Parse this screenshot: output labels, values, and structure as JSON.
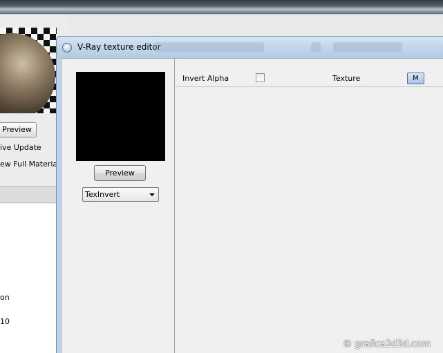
{
  "background_window": {
    "preview_label": "Preview",
    "checkboxes": [
      "ive Update",
      "ew Full Material"
    ],
    "rows": [
      "on",
      "10"
    ]
  },
  "dialog": {
    "title": "V-Ray texture editor",
    "preview_button": "Preview",
    "texture_type": "TexInvert",
    "params": {
      "invert_alpha_label": "Invert Alpha",
      "invert_alpha_checked": false,
      "texture_label": "Texture",
      "texture_map_button": "M"
    }
  },
  "watermark": "© grafica2d3d.com",
  "colors": {
    "titlebar": "#c3d7ea",
    "client_bg": "#f0f0f0",
    "map_button": "#a9c3e2"
  }
}
